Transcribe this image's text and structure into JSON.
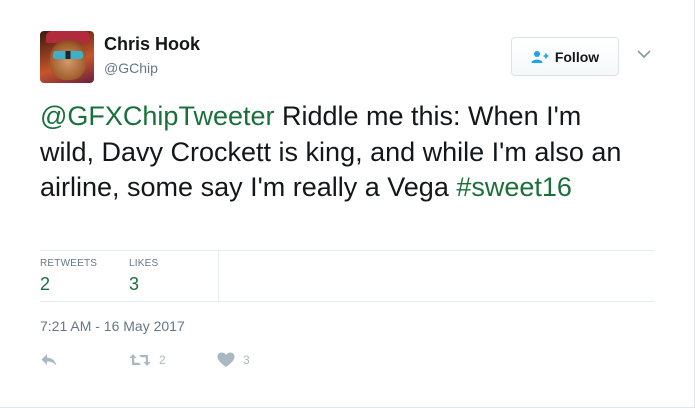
{
  "user": {
    "name": "Chris Hook",
    "handle": "@GChip"
  },
  "follow": {
    "label": "Follow"
  },
  "tweet": {
    "mention": "@GFXChipTweeter",
    "body": " Riddle me this:  When I'm wild, Davy Crockett is king, and while I'm also an airline, some say I'm really a Vega ",
    "hashtag": "#sweet16"
  },
  "stats": {
    "retweets_label": "RETWEETS",
    "retweets_value": "2",
    "likes_label": "LIKES",
    "likes_value": "3"
  },
  "timestamp": "7:21 AM - 16 May 2017",
  "actions": {
    "retweet_count": "2",
    "like_count": "3"
  },
  "colors": {
    "link": "#19703b",
    "muted": "#657786",
    "icon": "#aab8c2"
  }
}
